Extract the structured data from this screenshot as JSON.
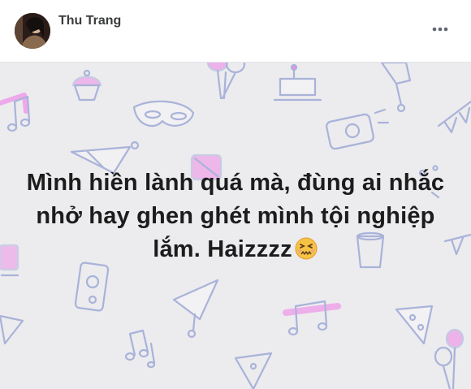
{
  "post": {
    "author_name": "Thu Trang",
    "status_text": "Mình hiền lành quá mà, đùng ai nhắc nhở hay ghen ghét mình tội nghiệp lắm. Haizzzz",
    "emoji": "persevering-face",
    "background_theme": "party-doodles",
    "colors": {
      "background": "#ecebee",
      "doodle_stroke": "#a9b3d9",
      "doodle_pink": "#ee8de8",
      "text": "#1c1c1c"
    }
  },
  "icons": {
    "more": "more-horizontal-icon",
    "avatar": "avatar"
  }
}
